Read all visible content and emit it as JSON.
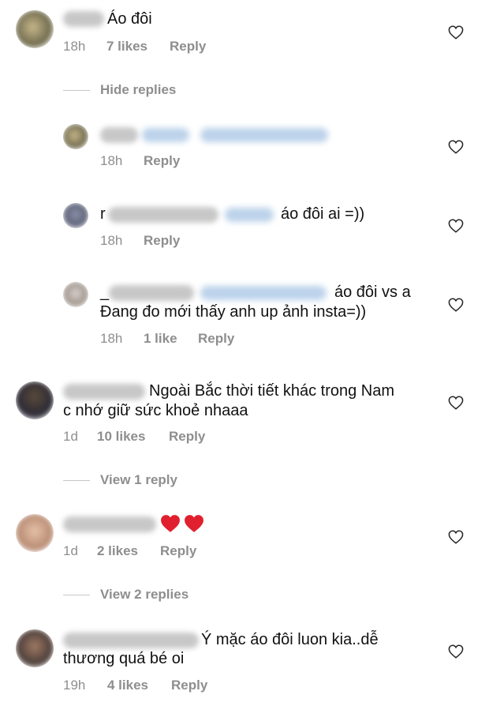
{
  "comments": [
    {
      "text": "Áo đôi",
      "time": "18h",
      "likes": "7 likes",
      "reply": "Reply"
    },
    {
      "text": "",
      "time": "18h",
      "reply": "Reply"
    },
    {
      "prefix": "r",
      "text": "áo đôi ai =))",
      "time": "18h",
      "reply": "Reply"
    },
    {
      "prefix": "_",
      "text_line1": "áo đôi vs a",
      "text_line2": "Đang đo mới thấy anh up ảnh insta=))",
      "time": "18h",
      "likes": "1 like",
      "reply": "Reply"
    },
    {
      "text_line1": "Ngoài Bắc thời tiết khác trong Nam",
      "text_line2": "c nhớ giữ sức khoẻ nhaaa",
      "time": "1d",
      "likes": "10 likes",
      "reply": "Reply"
    },
    {
      "time": "1d",
      "likes": "2 likes",
      "reply": "Reply",
      "emoji": "red-heart-emoji x2"
    },
    {
      "text_line1": "Ý mặc áo đôi luon kia..dễ",
      "text_line2": "thương quá bé oi",
      "time": "19h",
      "likes": "4 likes",
      "reply": "Reply"
    }
  ],
  "toggles": {
    "hide": "Hide replies",
    "view1": "View 1 reply",
    "view2": "View 2 replies"
  },
  "colors": {
    "meta": "#8e8e8e",
    "text": "#262626",
    "heart_emoji": "#e0202e",
    "mention": "#7aa6d6"
  },
  "icons": {
    "like": "heart-outline-icon"
  }
}
